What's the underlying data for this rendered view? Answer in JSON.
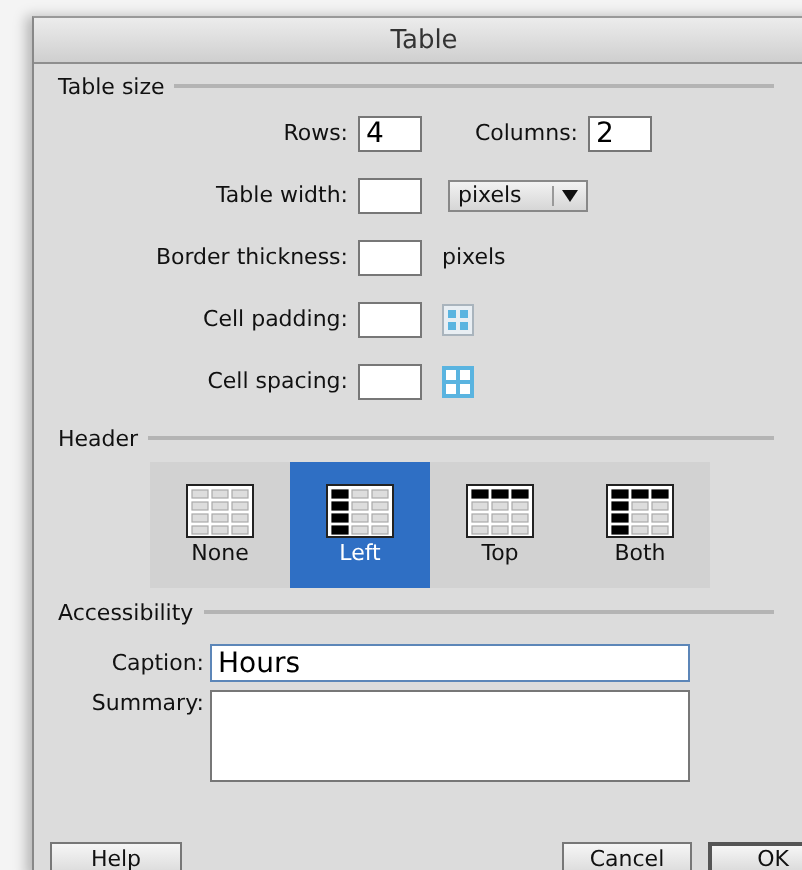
{
  "window": {
    "title": "Table"
  },
  "table_size": {
    "heading": "Table size",
    "rows": {
      "label": "Rows:",
      "value": "4"
    },
    "columns": {
      "label": "Columns:",
      "value": "2"
    },
    "table_width": {
      "label": "Table width:",
      "unit": "pixels"
    },
    "border_thickness": {
      "label": "Border thickness:",
      "unit": "pixels"
    },
    "cell_padding": {
      "label": "Cell padding:"
    },
    "cell_spacing": {
      "label": "Cell spacing:"
    }
  },
  "header": {
    "heading": "Header",
    "options": [
      {
        "kind": "none",
        "label": "None",
        "selected": false
      },
      {
        "kind": "left",
        "label": "Left",
        "selected": true
      },
      {
        "kind": "top",
        "label": "Top",
        "selected": false
      },
      {
        "kind": "both",
        "label": "Both",
        "selected": false
      }
    ]
  },
  "accessibility": {
    "heading": "Accessibility",
    "caption": {
      "label": "Caption:",
      "value": "Hours"
    },
    "summary": {
      "label": "Summary:"
    }
  },
  "buttons": {
    "help": "Help",
    "cancel": "Cancel",
    "ok": "OK"
  }
}
